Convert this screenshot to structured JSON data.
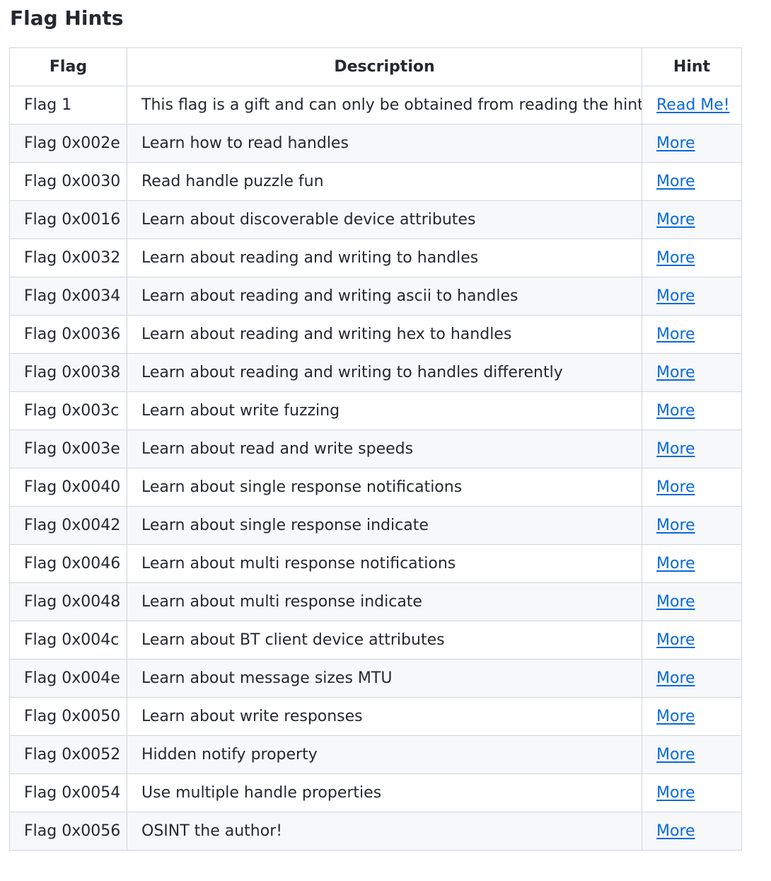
{
  "title": "Flag Hints",
  "table": {
    "headers": [
      "Flag",
      "Description",
      "Hint"
    ],
    "rows": [
      {
        "flag": "Flag 1",
        "description": "This flag is a gift and can only be obtained from reading the hint!",
        "hint": "Read Me!"
      },
      {
        "flag": "Flag 0x002e",
        "description": "Learn how to read handles",
        "hint": "More"
      },
      {
        "flag": "Flag 0x0030",
        "description": "Read handle puzzle fun",
        "hint": "More"
      },
      {
        "flag": "Flag 0x0016",
        "description": "Learn about discoverable device attributes",
        "hint": "More"
      },
      {
        "flag": "Flag 0x0032",
        "description": "Learn about reading and writing to handles",
        "hint": "More"
      },
      {
        "flag": "Flag 0x0034",
        "description": "Learn about reading and writing ascii to handles",
        "hint": "More"
      },
      {
        "flag": "Flag 0x0036",
        "description": "Learn about reading and writing hex to handles",
        "hint": "More"
      },
      {
        "flag": "Flag 0x0038",
        "description": "Learn about reading and writing to handles differently",
        "hint": "More"
      },
      {
        "flag": "Flag 0x003c",
        "description": "Learn about write fuzzing",
        "hint": "More"
      },
      {
        "flag": "Flag 0x003e",
        "description": "Learn about read and write speeds",
        "hint": "More"
      },
      {
        "flag": "Flag 0x0040",
        "description": "Learn about single response notifications",
        "hint": "More"
      },
      {
        "flag": "Flag 0x0042",
        "description": "Learn about single response indicate",
        "hint": "More"
      },
      {
        "flag": "Flag 0x0046",
        "description": "Learn about multi response notifications",
        "hint": "More"
      },
      {
        "flag": "Flag 0x0048",
        "description": "Learn about multi response indicate",
        "hint": "More"
      },
      {
        "flag": "Flag 0x004c",
        "description": "Learn about BT client device attributes",
        "hint": "More"
      },
      {
        "flag": "Flag 0x004e",
        "description": "Learn about message sizes MTU",
        "hint": "More"
      },
      {
        "flag": "Flag 0x0050",
        "description": "Learn about write responses",
        "hint": "More"
      },
      {
        "flag": "Flag 0x0052",
        "description": "Hidden notify property",
        "hint": "More"
      },
      {
        "flag": "Flag 0x0054",
        "description": "Use multiple handle properties",
        "hint": "More"
      },
      {
        "flag": "Flag 0x0056",
        "description": "OSINT the author!",
        "hint": "More"
      }
    ]
  },
  "colors": {
    "link": "#0969da",
    "border": "#d0d7de",
    "stripe": "#f6f8fa",
    "text": "#24292f"
  }
}
